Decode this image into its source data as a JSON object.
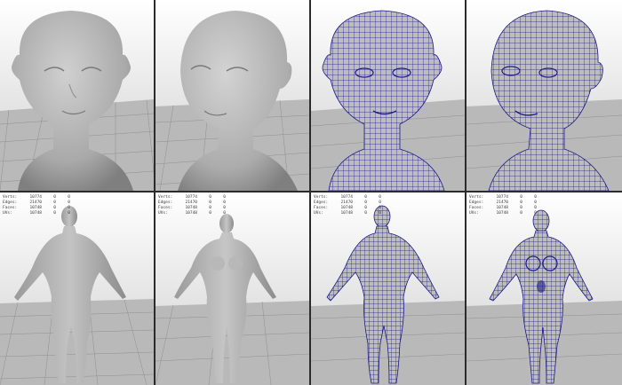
{
  "viewports": [
    {
      "name": "head-front-smooth",
      "top_text": "",
      "hud": null
    },
    {
      "name": "head-three-quarter-smooth",
      "top_text": "",
      "hud": null
    },
    {
      "name": "head-front-wireframe",
      "top_text": "",
      "hud": null
    },
    {
      "name": "head-three-quarter-wireframe",
      "top_text": "",
      "hud": null
    },
    {
      "name": "body-back-smooth",
      "top_text": "",
      "hud": {
        "rows": [
          {
            "k": "Verts:",
            "v": "10774",
            "n": "0",
            "m": "0"
          },
          {
            "k": "Edges:",
            "v": "21470",
            "n": "0",
            "m": "0"
          },
          {
            "k": "Faces:",
            "v": "10748",
            "n": "0",
            "m": "0"
          },
          {
            "k": "UVs:",
            "v": "10748",
            "n": "0",
            "m": "0"
          }
        ]
      }
    },
    {
      "name": "body-front-smooth",
      "top_text": "",
      "hud": {
        "rows": [
          {
            "k": "Verts:",
            "v": "10774",
            "n": "0",
            "m": "0"
          },
          {
            "k": "Edges:",
            "v": "21470",
            "n": "0",
            "m": "0"
          },
          {
            "k": "Faces:",
            "v": "10748",
            "n": "0",
            "m": "0"
          },
          {
            "k": "UVs:",
            "v": "10748",
            "n": "0",
            "m": "0"
          }
        ]
      }
    },
    {
      "name": "body-back-wireframe",
      "top_text": "",
      "hud": {
        "rows": [
          {
            "k": "Verts:",
            "v": "10774",
            "n": "0",
            "m": "0"
          },
          {
            "k": "Edges:",
            "v": "21470",
            "n": "0",
            "m": "0"
          },
          {
            "k": "Faces:",
            "v": "10748",
            "n": "0",
            "m": "0"
          },
          {
            "k": "UVs:",
            "v": "10748",
            "n": "0",
            "m": "0"
          }
        ]
      }
    },
    {
      "name": "body-front-wireframe",
      "top_text": "",
      "hud": {
        "rows": [
          {
            "k": "Verts:",
            "v": "10774",
            "n": "0",
            "m": "0"
          },
          {
            "k": "Edges:",
            "v": "21470",
            "n": "0",
            "m": "0"
          },
          {
            "k": "Faces:",
            "v": "10748",
            "n": "0",
            "m": "0"
          },
          {
            "k": "UVs:",
            "v": "10748",
            "n": "0",
            "m": "0"
          }
        ]
      }
    }
  ],
  "colors": {
    "sky_top": "#ffffff",
    "sky_bottom": "#c8c8c8",
    "floor": "#b9b9b9",
    "grid_line": "#8c8c8c",
    "skin": "#bdbdbd",
    "skin_shadow": "#7e7e7e",
    "wire": "#1d1a8a"
  }
}
